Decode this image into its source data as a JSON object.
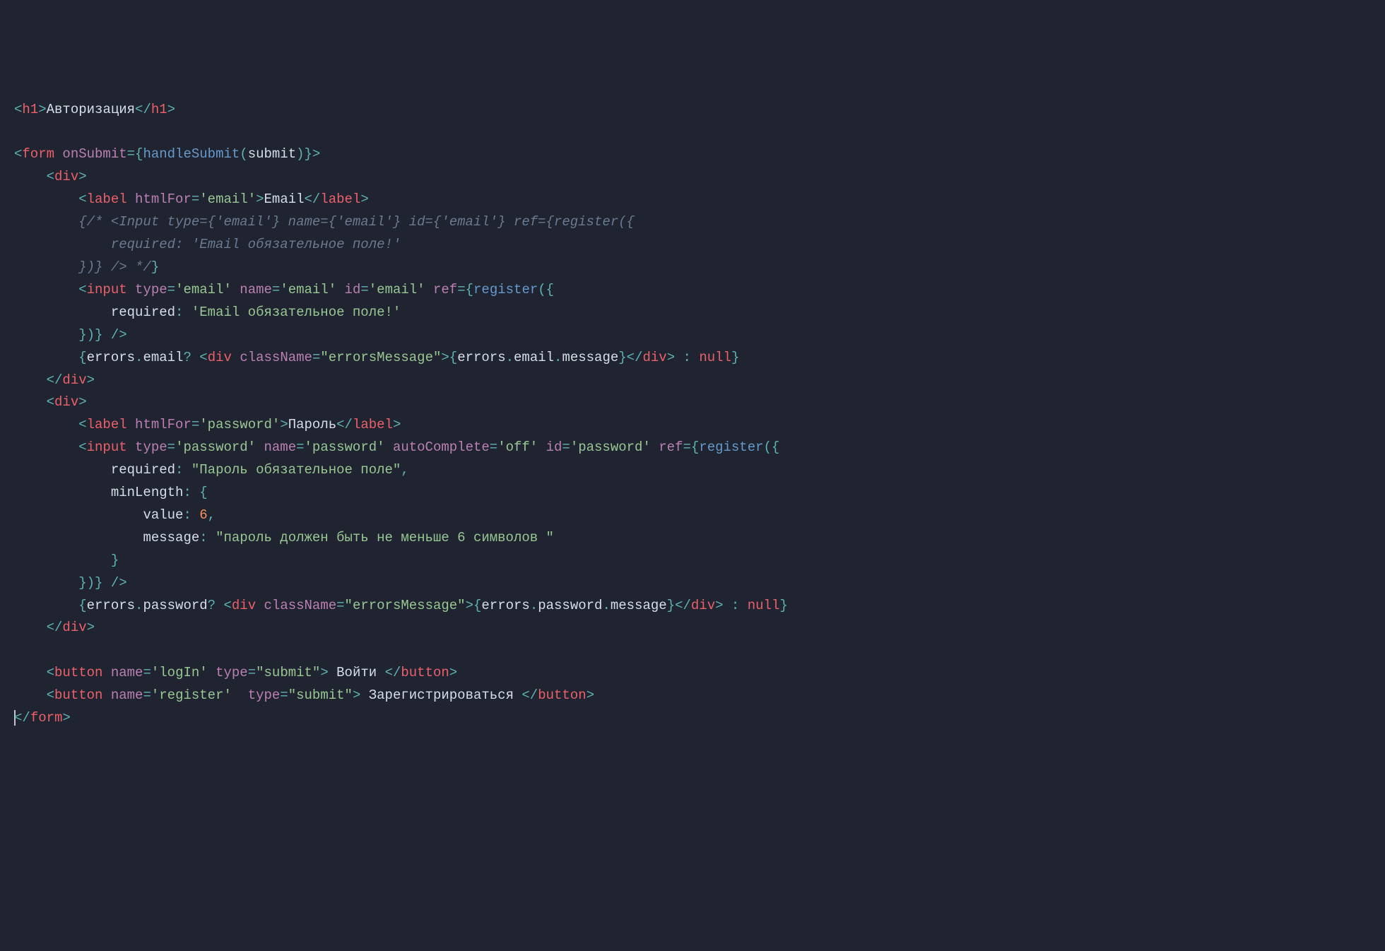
{
  "code": {
    "tags": {
      "h1": "h1",
      "form": "form",
      "div": "div",
      "label": "label",
      "input": "input",
      "button": "button",
      "Input": "Input"
    },
    "attrs": {
      "onSubmit": "onSubmit",
      "htmlFor": "htmlFor",
      "type": "type",
      "name": "name",
      "id": "id",
      "ref": "ref",
      "className": "className",
      "autoComplete": "autoComplete",
      "required": "required",
      "minLength": "minLength",
      "value": "value",
      "message": "message"
    },
    "funcs": {
      "handleSubmit": "handleSubmit",
      "register": "register",
      "submit": "submit"
    },
    "idents": {
      "errors": "errors",
      "email": "email",
      "password": "password",
      "message": "message"
    },
    "strings": {
      "email": "'email'",
      "password": "'password'",
      "off": "'off'",
      "logIn": "'logIn'",
      "reg": "'register'",
      "submit": "\"submit\"",
      "errMsg": "\"errorsMessage\"",
      "emailReq": "'Email обязательное поле!'",
      "pwdReq": "\"Пароль обязательное поле\"",
      "pwdMin": "\"пароль должен быть не меньше 6 символов \"",
      "commentEmailReq": "'Email обязательное поле!'"
    },
    "nums": {
      "six": "6"
    },
    "nullkw": "null",
    "text": {
      "auth": "Авторизация",
      "emailLabel": "Email",
      "pwdLabel": "Пароль",
      "login": " Войти ",
      "regBtn": " Зарегистрироваться "
    },
    "comment": {
      "open": "{/* ",
      "l1a": "<Input type={'email'} name={'email'} id={'email'} ref={register({",
      "l2": "required: 'Email обязательное поле!'",
      "l3": "})} /> */",
      "close": "}"
    }
  }
}
